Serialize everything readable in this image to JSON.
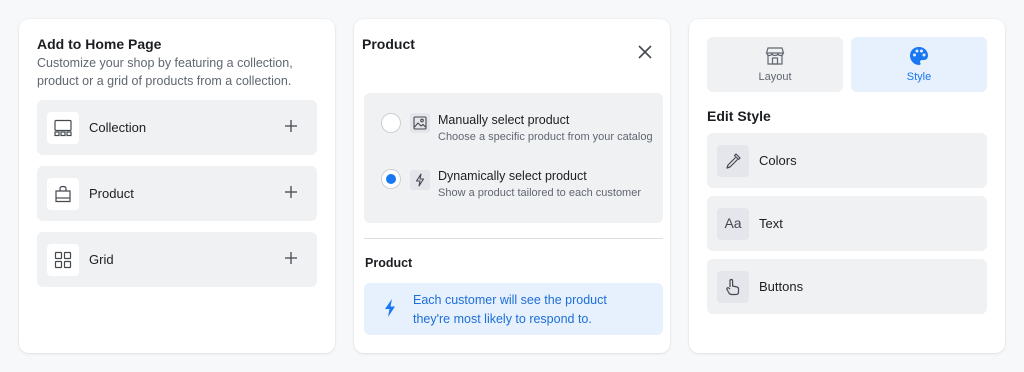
{
  "add_panel": {
    "title": "Add to Home Page",
    "description": "Customize your shop by featuring a collection, product or a grid of products from a collection.",
    "options": [
      {
        "label": "Collection",
        "icon": "collection-icon"
      },
      {
        "label": "Product",
        "icon": "shopping-bag-icon"
      },
      {
        "label": "Grid",
        "icon": "grid-icon"
      }
    ]
  },
  "product_panel": {
    "title": "Product",
    "choices": [
      {
        "title": "Manually select product",
        "description": "Choose a specific product from your catalog",
        "selected": false,
        "icon": "image-icon"
      },
      {
        "title": "Dynamically select product",
        "description": "Show a product tailored to each customer",
        "selected": true,
        "icon": "lightning-icon"
      }
    ],
    "section_title": "Product",
    "info_text": "Each customer will see the product they're most likely to respond to."
  },
  "style_panel": {
    "tabs": [
      {
        "label": "Layout",
        "active": false,
        "icon": "storefront-icon"
      },
      {
        "label": "Style",
        "active": true,
        "icon": "palette-icon"
      }
    ],
    "title": "Edit Style",
    "items": [
      {
        "label": "Colors",
        "icon": "eyedropper-icon"
      },
      {
        "label": "Text",
        "icon": "text-aa-icon",
        "glyph": "Aa"
      },
      {
        "label": "Buttons",
        "icon": "pointer-hand-icon"
      }
    ]
  },
  "colors": {
    "accent": "#1877f2",
    "accent_bg": "#e7f0fd",
    "row_bg": "#f0f1f3"
  }
}
